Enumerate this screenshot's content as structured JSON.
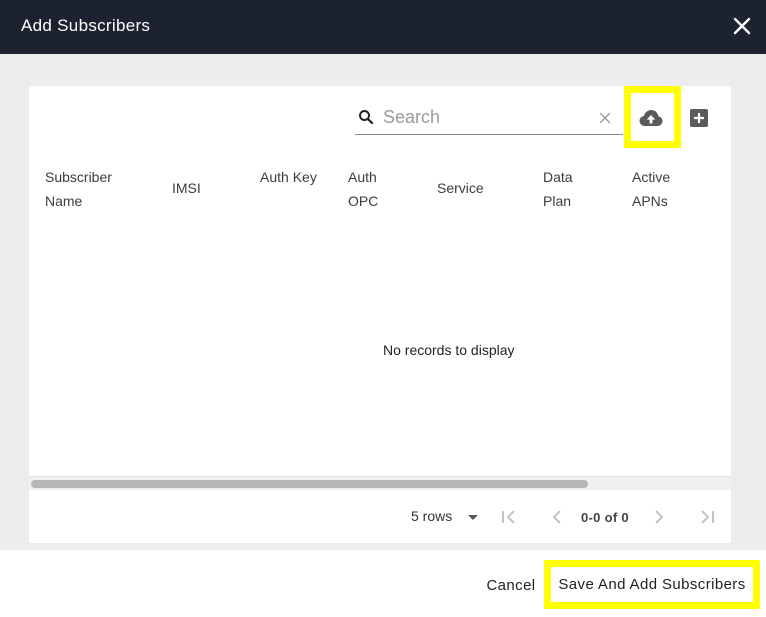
{
  "dialog": {
    "title": "Add Subscribers"
  },
  "search": {
    "placeholder": "Search",
    "value": ""
  },
  "table": {
    "columns": [
      "Subscriber Name",
      "IMSI",
      "Auth Key",
      "Auth OPC",
      "Service",
      "Data Plan",
      "Active APNs"
    ],
    "empty_message": "No records to display"
  },
  "pagination": {
    "rows_label": "5 rows",
    "count_label": "0-0 of 0"
  },
  "footer": {
    "cancel_label": "Cancel",
    "save_label": "Save And Add Subscribers"
  },
  "icons": {
    "close": "close-icon",
    "search": "search-icon",
    "clear": "clear-icon",
    "upload": "cloud-upload-icon",
    "add": "add-box-icon"
  },
  "colors": {
    "header_bg": "#1d2230",
    "highlight": "#ffff00"
  }
}
